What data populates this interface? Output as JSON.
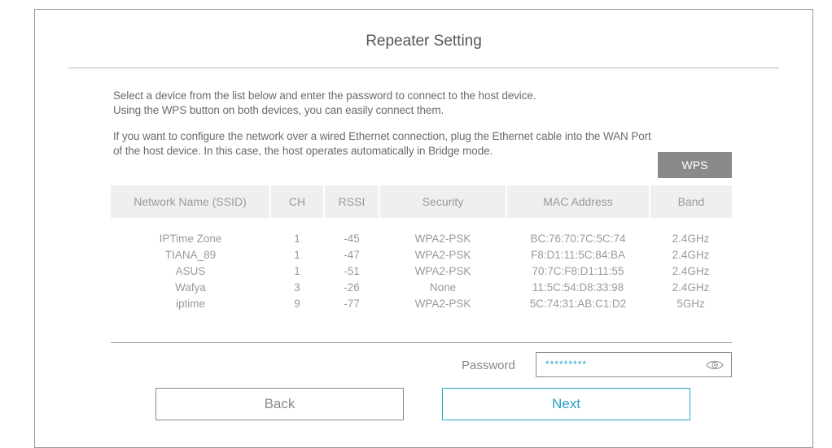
{
  "page": {
    "title": "Repeater Setting"
  },
  "description": {
    "line1": "Select a device from the list below and enter the password to connect to the host device.",
    "line2": "Using the WPS button on both devices, you can easily connect them.",
    "line3": "If you want to configure the network over a wired Ethernet connection, plug the Ethernet cable into the WAN Port",
    "line4": "of the host device. In this case, the host operates automatically in Bridge mode."
  },
  "wps": {
    "label": "WPS"
  },
  "table": {
    "headers": [
      "Network Name (SSID)",
      "CH",
      "RSSI",
      "Security",
      "MAC Address",
      "Band"
    ],
    "rows": [
      [
        "IPTime Zone",
        "1",
        "-45",
        "WPA2-PSK",
        "BC:76:70:7C:5C:74",
        "2.4GHz"
      ],
      [
        "TIANA_89",
        "1",
        "-47",
        "WPA2-PSK",
        "F8:D1:11:5C:84:BA",
        "2.4GHz"
      ],
      [
        "ASUS",
        "1",
        "-51",
        "WPA2-PSK",
        "70:7C:F8:D1:11:55",
        "2.4GHz"
      ],
      [
        "Wafya",
        "3",
        "-26",
        "None",
        "11:5C:54:D8:33:98",
        "2.4GHz"
      ],
      [
        "iptime",
        "9",
        "-77",
        "WPA2-PSK",
        "5C:74:31:AB:C1:D2",
        "5GHz"
      ]
    ]
  },
  "password": {
    "label": "Password",
    "value": "*********",
    "icon": "eye-icon"
  },
  "buttons": {
    "back": "Back",
    "next": "Next"
  },
  "colors": {
    "accent": "#2aa7c9",
    "wps_bg": "#8a8a8a",
    "header_bg": "#efefef"
  }
}
